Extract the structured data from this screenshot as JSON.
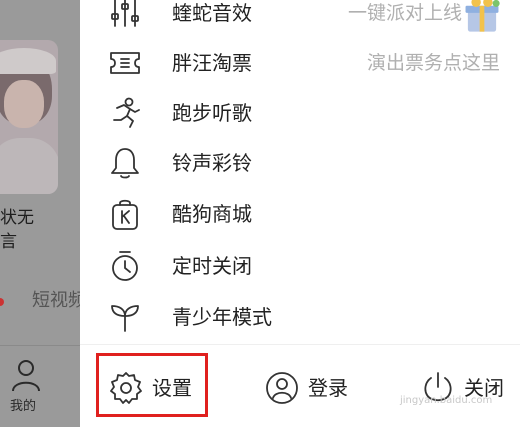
{
  "background": {
    "card_text_line1": "状无",
    "card_text_line2": "言",
    "short_video": "短视频",
    "nav_mine": "我的"
  },
  "menu": [
    {
      "label": "蝰蛇音效",
      "hint": "一键派对上线",
      "icon": "equalizer-sliders-icon"
    },
    {
      "label": "胖汪淘票",
      "hint": "演出票务点这里",
      "icon": "ticket-icon"
    },
    {
      "label": "跑步听歌",
      "hint": "",
      "icon": "running-person-icon"
    },
    {
      "label": "铃声彩铃",
      "hint": "",
      "icon": "bell-icon"
    },
    {
      "label": "酷狗商城",
      "hint": "",
      "icon": "shopping-bag-k-icon"
    },
    {
      "label": "定时关闭",
      "hint": "",
      "icon": "timer-icon"
    },
    {
      "label": "青少年模式",
      "hint": "",
      "icon": "sprout-icon"
    }
  ],
  "bottom": {
    "settings": "设置",
    "login": "登录",
    "close": "关闭"
  },
  "watermark": "jingyan.baidu.com",
  "colors": {
    "highlight_border": "#e0201e",
    "dim_overlay": "#9a9a9a",
    "hint_text": "#b0b0b0"
  }
}
